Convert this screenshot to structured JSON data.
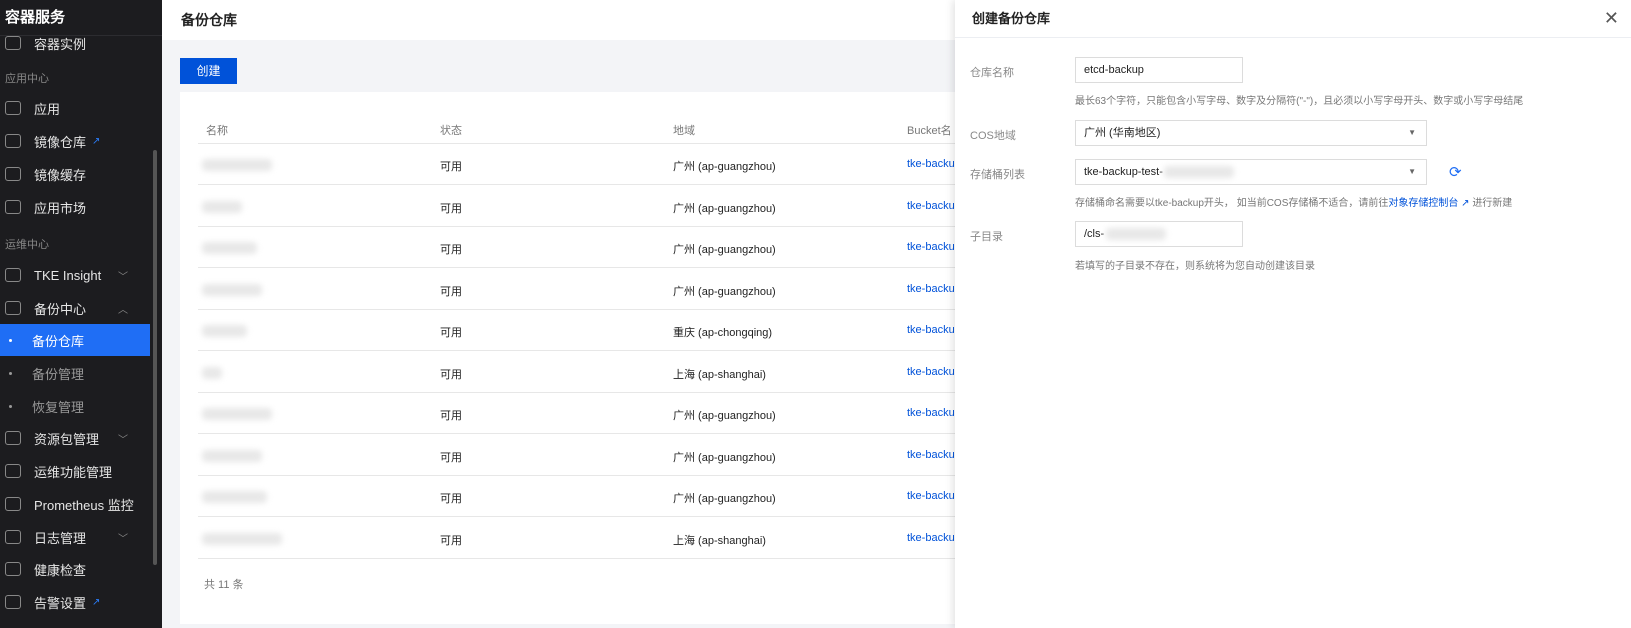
{
  "sidebar": {
    "brand": "容器服务",
    "items": [
      {
        "label": "容器实例",
        "type": "item"
      },
      {
        "label": "应用中心",
        "type": "group"
      },
      {
        "label": "应用",
        "type": "item"
      },
      {
        "label": "镜像仓库",
        "type": "item",
        "external": true
      },
      {
        "label": "镜像缓存",
        "type": "item"
      },
      {
        "label": "应用市场",
        "type": "item"
      },
      {
        "label": "运维中心",
        "type": "group"
      },
      {
        "label": "TKE Insight",
        "type": "item",
        "chevron": "down"
      },
      {
        "label": "备份中心",
        "type": "item",
        "chevron": "up"
      },
      {
        "label": "备份仓库",
        "type": "sub",
        "active": true
      },
      {
        "label": "备份管理",
        "type": "sub"
      },
      {
        "label": "恢复管理",
        "type": "sub"
      },
      {
        "label": "资源包管理",
        "type": "item",
        "chevron": "down"
      },
      {
        "label": "运维功能管理",
        "type": "item"
      },
      {
        "label": "Prometheus 监控",
        "type": "item"
      },
      {
        "label": "日志管理",
        "type": "item",
        "chevron": "down"
      },
      {
        "label": "健康检查",
        "type": "item"
      },
      {
        "label": "告警设置",
        "type": "item",
        "external": true
      }
    ]
  },
  "header": {
    "title": "备份仓库"
  },
  "toolbar": {
    "create_label": "创建"
  },
  "table": {
    "columns": [
      "名称",
      "状态",
      "地域",
      "Bucket名"
    ],
    "rows": [
      {
        "status": "可用",
        "region": "广州 (ap-guangzhou)",
        "bucket": "tke-backu"
      },
      {
        "status": "可用",
        "region": "广州 (ap-guangzhou)",
        "bucket": "tke-backu"
      },
      {
        "status": "可用",
        "region": "广州 (ap-guangzhou)",
        "bucket": "tke-backu"
      },
      {
        "status": "可用",
        "region": "广州 (ap-guangzhou)",
        "bucket": "tke-backu"
      },
      {
        "status": "可用",
        "region": "重庆 (ap-chongqing)",
        "bucket": "tke-backu"
      },
      {
        "status": "可用",
        "region": "上海 (ap-shanghai)",
        "bucket": "tke-backu"
      },
      {
        "status": "可用",
        "region": "广州 (ap-guangzhou)",
        "bucket": "tke-backu"
      },
      {
        "status": "可用",
        "region": "广州 (ap-guangzhou)",
        "bucket": "tke-backu"
      },
      {
        "status": "可用",
        "region": "广州 (ap-guangzhou)",
        "bucket": "tke-backu"
      },
      {
        "status": "可用",
        "region": "上海 (ap-shanghai)",
        "bucket": "tke-backu"
      }
    ],
    "total": "共 11 条"
  },
  "drawer": {
    "title": "创建备份仓库",
    "name_label": "仓库名称",
    "name_value": "etcd-backup",
    "name_hint": "最长63个字符，只能包含小写字母、数字及分隔符(\"-\")，且必须以小写字母开头、数字或小写字母结尾",
    "region_label": "COS地域",
    "region_value": "广州 (华南地区)",
    "bucket_label": "存储桶列表",
    "bucket_value": "tke-backup-test-",
    "bucket_hint_prefix": "存储桶命名需要以tke-backup开头， 如当前COS存储桶不适合，请前往",
    "bucket_hint_link": "对象存储控制台",
    "bucket_hint_suffix": "进行新建",
    "subdir_label": "子目录",
    "subdir_value": "/cls-",
    "subdir_hint": "若填写的子目录不存在，则系统将为您自动创建该目录"
  }
}
